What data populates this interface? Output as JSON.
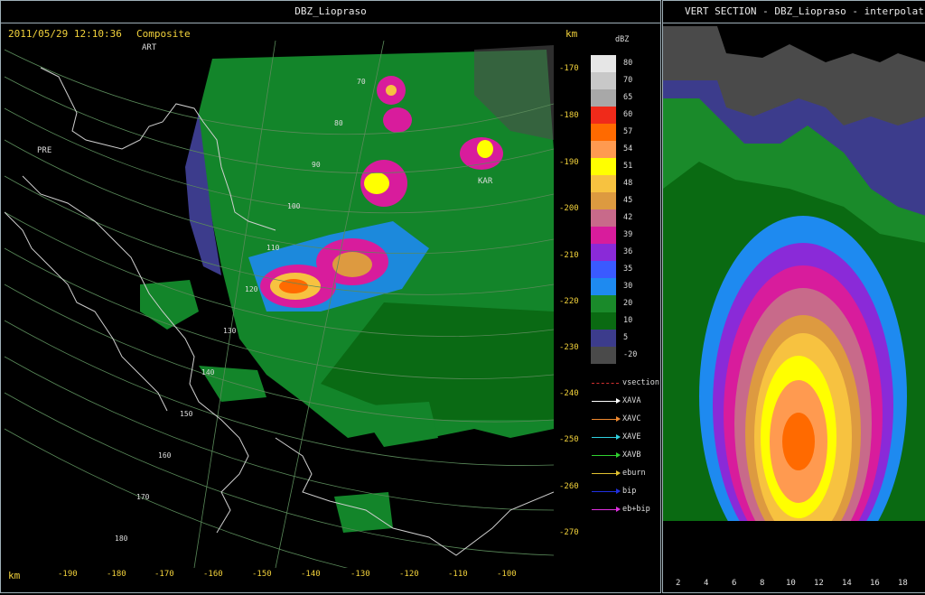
{
  "left_panel": {
    "title": "DBZ_Liopraso",
    "datetime": "2011/05/29 12:10:36",
    "mode": "Composite",
    "unit_right": "km",
    "unit_bottom": "km",
    "x_ticks": [
      "-190",
      "-180",
      "-170",
      "-160",
      "-150",
      "-140",
      "-130",
      "-120",
      "-110",
      "-100"
    ],
    "y_ticks": [
      "-170",
      "-180",
      "-190",
      "-200",
      "-210",
      "-220",
      "-230",
      "-240",
      "-250",
      "-260",
      "-270"
    ],
    "place_labels": [
      "ART",
      "PRE",
      "KAR"
    ],
    "range_labels": [
      "70",
      "80",
      "90",
      "100",
      "110",
      "120",
      "130",
      "140",
      "150",
      "160",
      "170",
      "180"
    ]
  },
  "colorbar": {
    "unit": "dBZ",
    "levels": [
      {
        "label": "80",
        "color": "#e6e6e6"
      },
      {
        "label": "70",
        "color": "#c8c8c8"
      },
      {
        "label": "65",
        "color": "#a8a8a8"
      },
      {
        "label": "60",
        "color": "#f02a1a"
      },
      {
        "label": "57",
        "color": "#ff6a00"
      },
      {
        "label": "54",
        "color": "#ff9a50"
      },
      {
        "label": "51",
        "color": "#ffff00"
      },
      {
        "label": "48",
        "color": "#f7c240"
      },
      {
        "label": "45",
        "color": "#dd9a40"
      },
      {
        "label": "42",
        "color": "#c86a8a"
      },
      {
        "label": "39",
        "color": "#d81c9c"
      },
      {
        "label": "36",
        "color": "#8a2ad8"
      },
      {
        "label": "35",
        "color": "#3a5aff"
      },
      {
        "label": "30",
        "color": "#1e8af0"
      },
      {
        "label": "20",
        "color": "#1a8a2a"
      },
      {
        "label": "10",
        "color": "#0a6a12"
      },
      {
        "label": "5",
        "color": "#3c3c8c"
      },
      {
        "label": "-20",
        "color": "#4a4a4a"
      }
    ],
    "overlays": [
      {
        "label": "vsection",
        "color": "#d03030",
        "style": "dashed"
      },
      {
        "label": "XAVA",
        "color": "#ffffff"
      },
      {
        "label": "XAVC",
        "color": "#f08a30"
      },
      {
        "label": "XAVE",
        "color": "#30d0e0"
      },
      {
        "label": "XAVB",
        "color": "#30d030"
      },
      {
        "label": "eburn",
        "color": "#e0c030"
      },
      {
        "label": "bip",
        "color": "#2030e0"
      },
      {
        "label": "eb+bip",
        "color": "#e030e0"
      }
    ]
  },
  "right_panel": {
    "title": "VERT SECTION - DBZ_Liopraso - interpolat",
    "x_ticks": [
      "2",
      "4",
      "6",
      "8",
      "10",
      "12",
      "14",
      "16",
      "18"
    ]
  }
}
